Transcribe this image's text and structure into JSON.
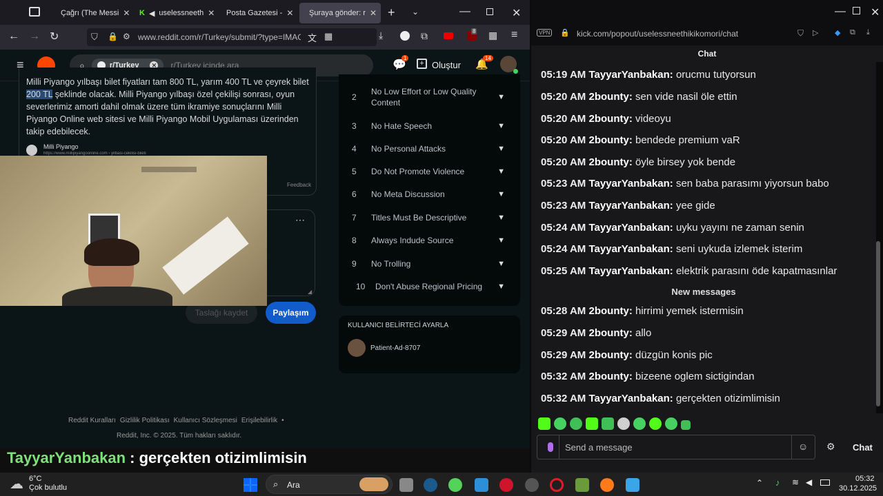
{
  "browser": {
    "tabs": [
      {
        "label": "Çağrı (The Messi"
      },
      {
        "label": "uselessneeth"
      },
      {
        "label": "Posta Gazetesi -"
      },
      {
        "label": "Şuraya gönder: r"
      }
    ],
    "url": "www.reddit.com/r/Turkey/submit/?type=IMAG",
    "badge_count": "8"
  },
  "reddit": {
    "subreddit": "r/Turkey",
    "search_placeholder": "r/Turkey içinde ara",
    "create_label": "Oluştur",
    "notif_count": "14",
    "chat_count": "1",
    "post_text_before": "Milli Piyango yılbaşı bilet fiyatları tam 800 TL, yarım 400 TL ve çeyrek bilet",
    "post_highlight": "200 TL",
    "post_text_after": "şeklinde olacak. Milli Piyango yılbaşı özel çekilişi sonrası, oyun severlerimiz amorti dahil olmak üzere tüm ikramiye sonuçlarını Milli Piyango Online web sitesi ve Milli Piyango Mobil Uygulaması üzerinden takip edebilecek.",
    "source_name": "Milli Piyango",
    "source_url": "https://www.millipiyangoonline.com › yilbasi-cekilisi-bileti",
    "feedback": "Feedback",
    "draft_button": "Taslağı kaydet",
    "post_button": "Paylaşım",
    "rules": [
      {
        "num": "2",
        "label": "No Low Effort or Low Quality Content"
      },
      {
        "num": "3",
        "label": "No Hate Speech"
      },
      {
        "num": "4",
        "label": "No Personal Attacks"
      },
      {
        "num": "5",
        "label": "Do Not Promote Violence"
      },
      {
        "num": "6",
        "label": "No Meta Discussion"
      },
      {
        "num": "7",
        "label": "Titles Must Be Descriptive"
      },
      {
        "num": "8",
        "label": "Always Indude Source"
      },
      {
        "num": "9",
        "label": "No Trolling"
      },
      {
        "num": "10",
        "label": "Don't Abuse Regional Pricing"
      }
    ],
    "flair_title": "KULLANICI BELİRTECİ AYARLA",
    "username": "Patient-Ad-8707",
    "footer_links": [
      "Reddit Kuralları",
      "Gizlilik Politikası",
      "Kullanıcı Sözleşmesi",
      "Erişilebilirlik"
    ],
    "footer_copy": "Reddit, Inc. © 2025. Tüm hakları saklıdır."
  },
  "overlay": {
    "user": "TayyarYanbakan",
    "text": " : gerçekten otizimlimisin"
  },
  "kick": {
    "url": "kick.com/popout/uselessneethikikomori/chat",
    "header": "Chat",
    "messages": [
      {
        "time": "05:19 AM",
        "user": "TayyarYanbakan:",
        "text": "orucmu tutyorsun"
      },
      {
        "time": "05:20 AM",
        "user": "2bounty:",
        "text": "sen vide nasil öle ettin"
      },
      {
        "time": "05:20 AM",
        "user": "2bounty:",
        "text": "videoyu"
      },
      {
        "time": "05:20 AM",
        "user": "2bounty:",
        "text": "bendede premium vaR"
      },
      {
        "time": "05:20 AM",
        "user": "2bounty:",
        "text": "öyle birsey yok bende"
      },
      {
        "time": "05:23 AM",
        "user": "TayyarYanbakan:",
        "text": "sen baba parasımı yiyorsun babo"
      },
      {
        "time": "05:23 AM",
        "user": "TayyarYanbakan:",
        "text": "yee gide"
      },
      {
        "time": "05:24 AM",
        "user": "TayyarYanbakan:",
        "text": "uyku yayını ne zaman senin"
      },
      {
        "time": "05:24 AM",
        "user": "TayyarYanbakan:",
        "text": "seni uykuda izlemek isterim"
      },
      {
        "time": "05:25 AM",
        "user": "TayyarYanbakan:",
        "text": "elektrik parasını öde kapatmasınlar"
      }
    ],
    "new_messages": "New messages",
    "messages_new": [
      {
        "time": "05:28 AM",
        "user": "2bounty:",
        "text": "hirrimi yemek istermisin"
      },
      {
        "time": "05:29 AM",
        "user": "2bounty:",
        "text": "allo"
      },
      {
        "time": "05:29 AM",
        "user": "2bounty:",
        "text": "düzgün konis pic"
      },
      {
        "time": "05:32 AM",
        "user": "2bounty:",
        "text": "bizeene oglem sictigindan"
      },
      {
        "time": "05:32 AM",
        "user": "TayyarYanbakan:",
        "text": "gerçekten otizimlimisin"
      }
    ],
    "input_placeholder": "Send a message",
    "chat_button": "Chat"
  },
  "taskbar": {
    "temperature": "6°C",
    "weather": "Çok bulutlu",
    "search": "Ara",
    "time": "05:32",
    "date": "30.12.2025"
  }
}
